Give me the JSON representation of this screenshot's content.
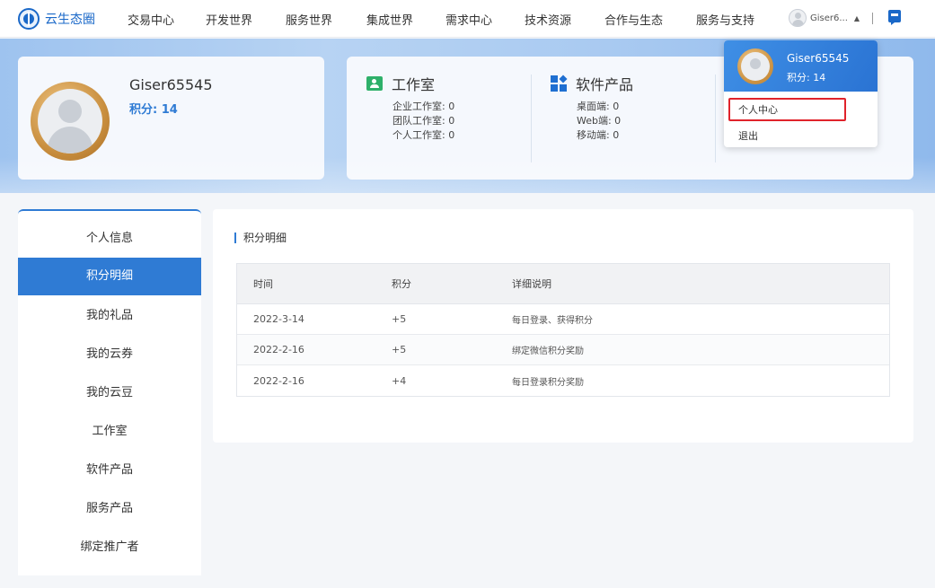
{
  "nav": {
    "logo": "云生态圈",
    "items": [
      "交易中心",
      "开发世界",
      "服务世界",
      "集成世界",
      "需求中心",
      "技术资源",
      "合作与生态",
      "服务与支持"
    ],
    "user_short": "Giser6...",
    "caret": "▲",
    "separator": "|"
  },
  "profile": {
    "name": "Giser65545",
    "points_label": "积分: 14"
  },
  "stats": {
    "studio": {
      "title": "工作室",
      "lines": [
        "企业工作室: 0",
        "团队工作室: 0",
        "个人工作室: 0"
      ]
    },
    "software": {
      "title": "软件产品",
      "lines": [
        "桌面端: 0",
        "Web端: 0",
        "移动端: 0"
      ]
    }
  },
  "dropdown": {
    "name": "Giser65545",
    "points_label": "积分: 14",
    "items": [
      "个人中心",
      "退出"
    ]
  },
  "sidebar": {
    "items": [
      "个人信息",
      "积分明细",
      "我的礼品",
      "我的云券",
      "我的云豆",
      "工作室",
      "软件产品",
      "服务产品",
      "绑定推广者"
    ],
    "active": "积分明细"
  },
  "main": {
    "title": "积分明细",
    "columns": [
      "时间",
      "积分",
      "详细说明"
    ],
    "rows": [
      [
        "2022-3-14",
        "+5",
        "每日登录、获得积分"
      ],
      [
        "2022-2-16",
        "+5",
        "绑定微信积分奖励"
      ],
      [
        "2022-2-16",
        "+4",
        "每日登录积分奖励"
      ]
    ]
  },
  "colors": {
    "accent": "#2f7bd4",
    "highlight_border": "#e0232b"
  }
}
